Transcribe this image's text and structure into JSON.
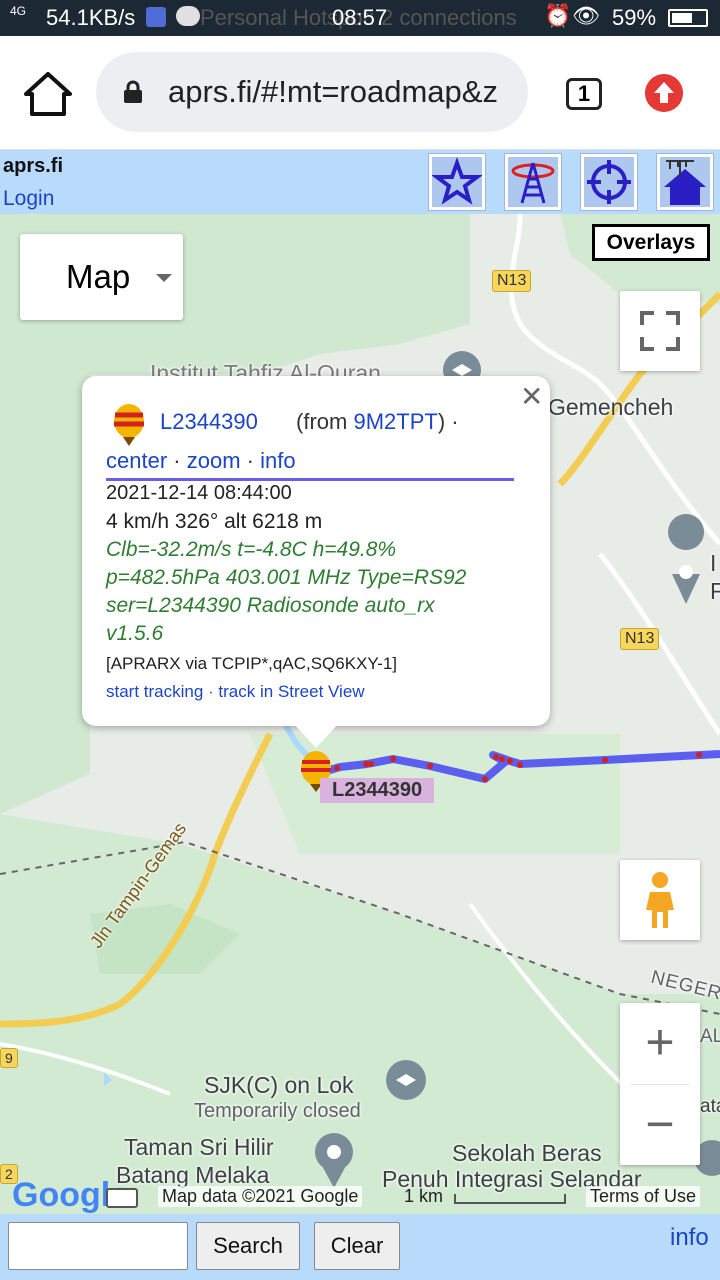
{
  "status": {
    "signal": "4G",
    "rate": "54.1KB/s",
    "notification": "Personal Hotspot: 2 connections",
    "time": "08:57",
    "battery": "59%"
  },
  "browser": {
    "url": "aprs.fi/#!mt=roadmap&z",
    "tab_count": "1"
  },
  "header": {
    "brand": "aprs.fi",
    "login": "Login"
  },
  "map": {
    "type_label": "Map",
    "overlays_label": "Overlays",
    "labels": {
      "institut": "Institut Tahfiz Al-Quran",
      "gemencheh": "Gemencheh",
      "right_i": "I",
      "right_f": "F",
      "jln": "Jln Tampin-Gemas",
      "negeri": "NEGERI",
      "al": "AL",
      "sjk": "SJK(C) on Lok",
      "temp_closed": "Temporarily closed",
      "taman1": "Taman Sri Hilir",
      "taman2": "Batang Melaka",
      "sekolah1": "Sekolah Beras",
      "sekolah2": "Penuh Integrasi Selandar",
      "ata": "ata",
      "left9": "9",
      "left2": "2"
    },
    "roads": {
      "n13_top": "N13",
      "n13_mid": "N13"
    },
    "station_label": "L2344390",
    "attribution": {
      "google": "Google",
      "map_data": "Map data ©2021 Google",
      "scale": "1 km",
      "terms": "Terms of Use"
    },
    "colors": {
      "track": "#5a5ff0",
      "track_points": "#d32020",
      "water": "#aadaff"
    }
  },
  "popup": {
    "callsign": "L2344390",
    "from_prefix": "(from",
    "from_call": "9M2TPT",
    "from_suffix": ") ·",
    "links": {
      "center": "center",
      "zoom": "zoom",
      "info": "info",
      "sep": " · "
    },
    "datetime": "2021-12-14 08:44:00",
    "motion": "4 km/h 326° alt 6218 m",
    "comment": [
      "Clb=-32.2m/s t=-4.8C h=49.8%",
      "p=482.5hPa 403.001 MHz Type=RS92",
      "ser=L2344390 Radiosonde auto_rx",
      "v1.5.6"
    ],
    "path": "[APRARX via TCPIP*,qAC,SQ6KXY-1]",
    "actions": {
      "tracking": "start tracking",
      "sep": " · ",
      "streetview": "track in Street View"
    }
  },
  "bottom": {
    "search_placeholder": "",
    "search_label": "Search",
    "clear_label": "Clear",
    "info_label": "info"
  }
}
